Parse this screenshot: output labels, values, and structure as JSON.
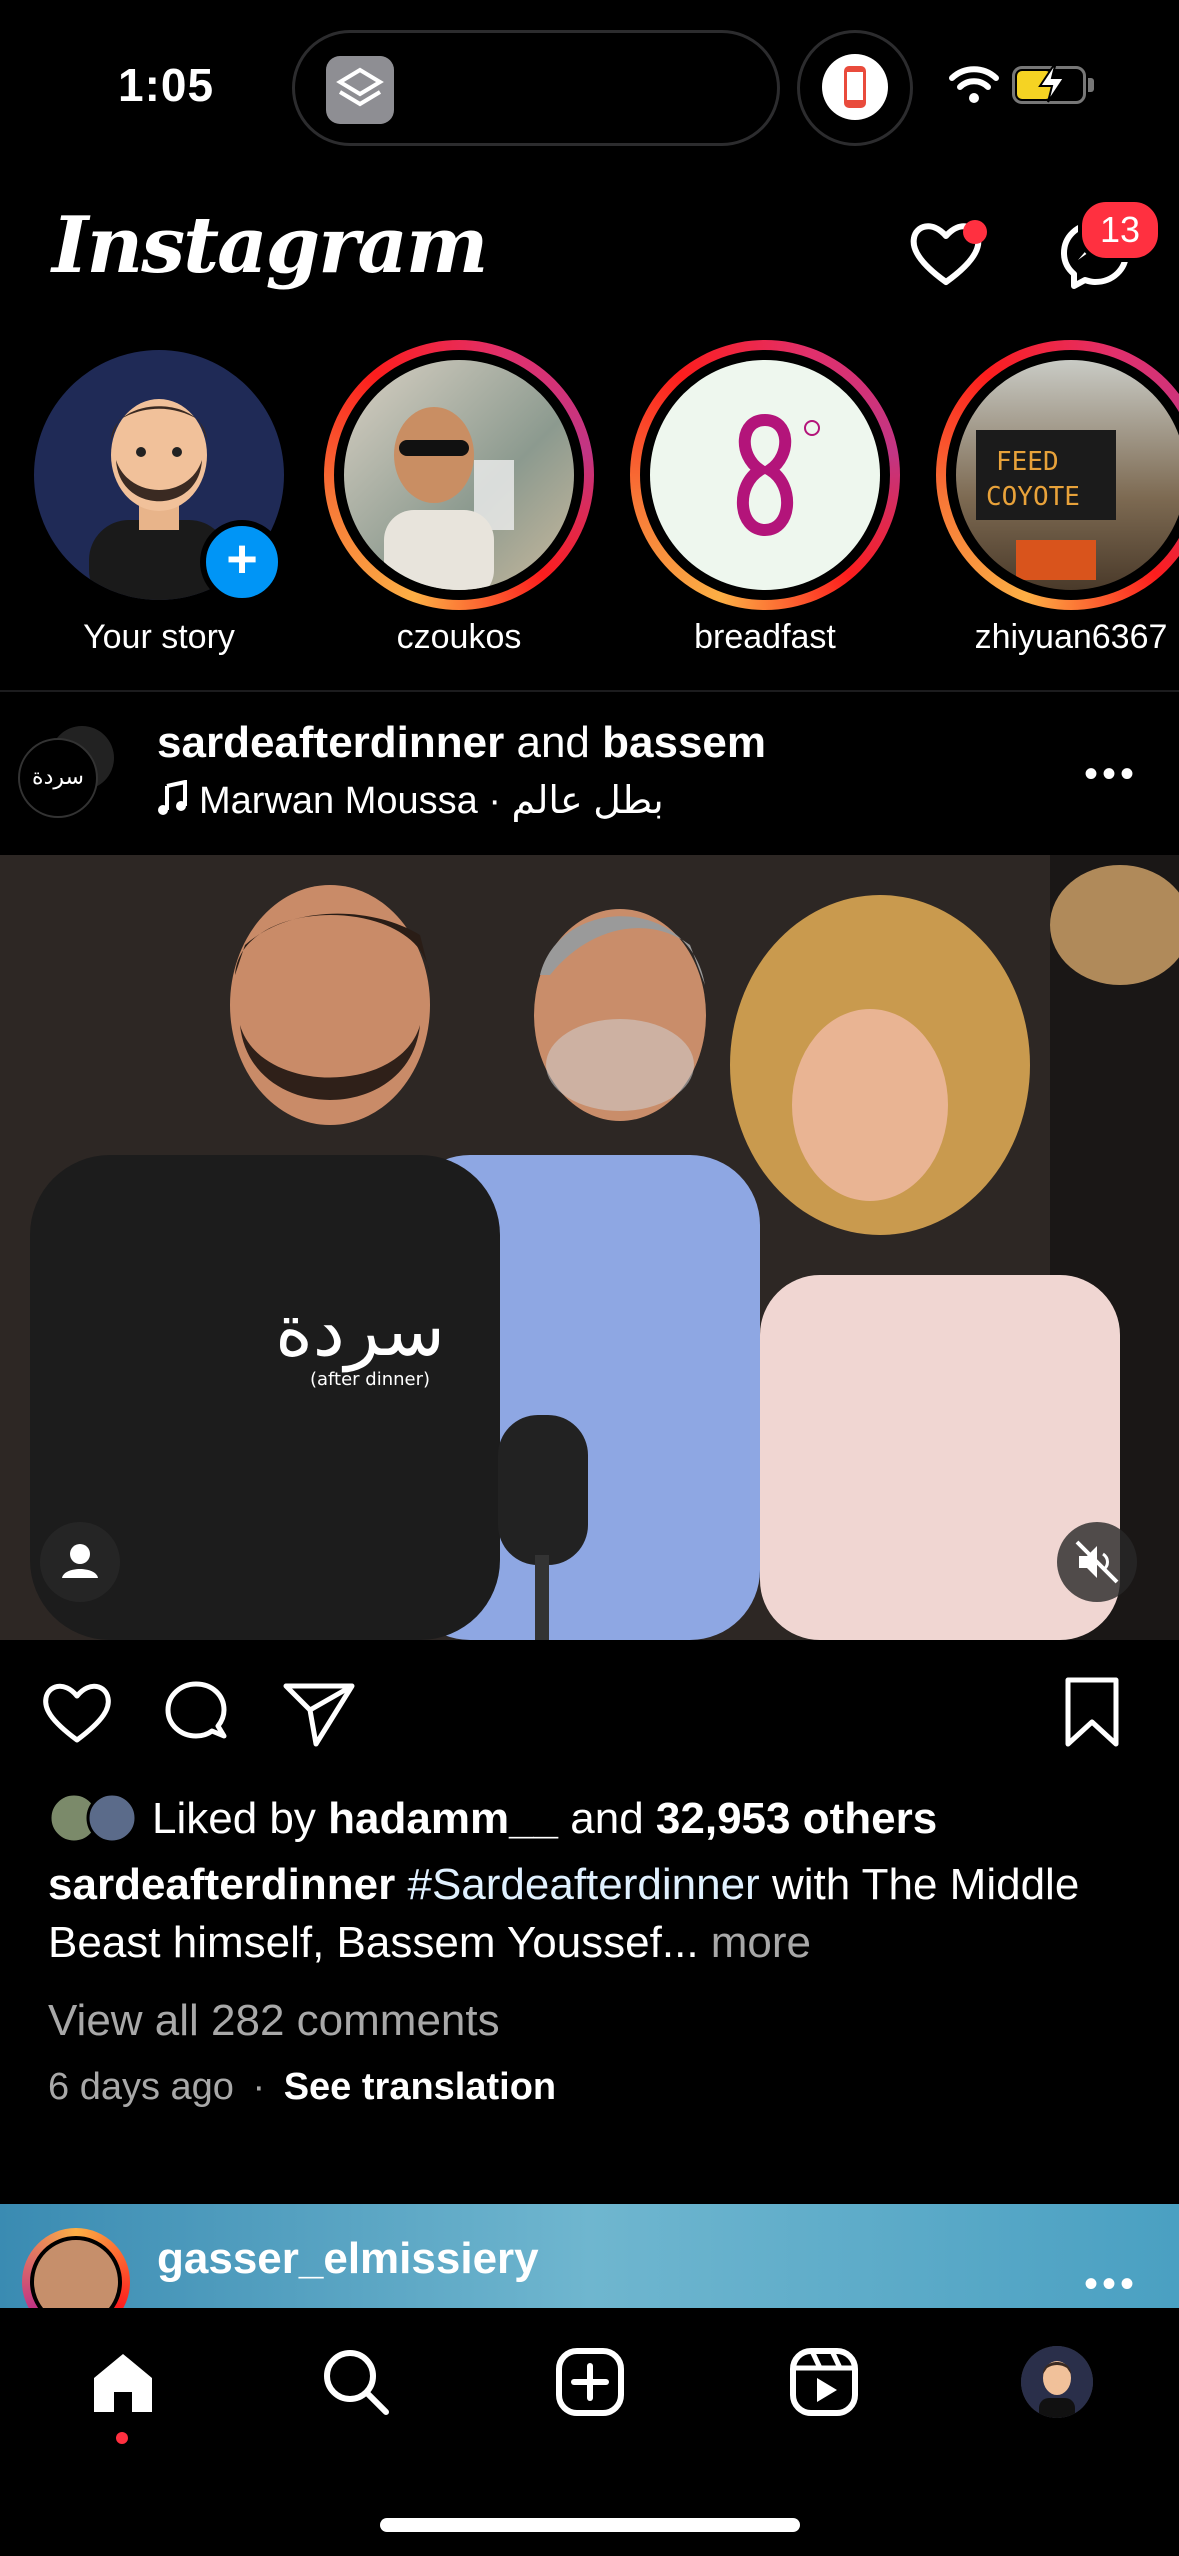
{
  "status_bar": {
    "time": "1:05",
    "wifi_icon": "wifi-icon",
    "battery_icon": "battery-charging-icon"
  },
  "header": {
    "logo_text": "Instagram",
    "activity_icon": "heart-icon",
    "messages_icon": "messenger-icon",
    "messages_badge": "13"
  },
  "stories": [
    {
      "label": "Your story"
    },
    {
      "label": "czoukos"
    },
    {
      "label": "breadfast"
    },
    {
      "label": "zhiyuan6367"
    }
  ],
  "post": {
    "user1": "sardeafterdinner",
    "joiner": "and",
    "user2": "bassem",
    "music": "Marwan Moussa · بطل عالم",
    "liked_prefix": "Liked by",
    "liked_user": "hadamm__",
    "liked_joiner": "and",
    "liked_count": "32,953 others",
    "caption_user": "sardeafterdinner",
    "caption_hashtag": "#Sardeafterdinner",
    "caption_text": "with The Middle Beast himself, Bassem Youssef...",
    "caption_more": "more",
    "view_comments": "View all 282 comments",
    "time_ago": "6 days ago",
    "separator": "·",
    "see_translation": "See translation",
    "shirt_text": "سردة",
    "shirt_sub": "(after dinner)"
  },
  "next_post": {
    "user": "gasser_elmissiery"
  },
  "colors": {
    "accent_red": "#ff3040",
    "link_blue": "#0095f6"
  }
}
